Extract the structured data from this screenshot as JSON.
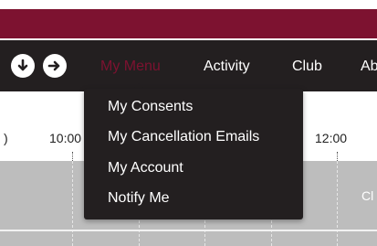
{
  "navbar": {
    "items": [
      {
        "label": "My Menu",
        "active": true
      },
      {
        "label": "Activity"
      },
      {
        "label": "Club"
      },
      {
        "label": "Ab"
      }
    ],
    "icons": [
      "circle-arrow-down-icon",
      "circle-arrow-right-icon"
    ]
  },
  "dropdown": {
    "items": [
      {
        "label": "My Consents"
      },
      {
        "label": "My Cancellation Emails"
      },
      {
        "label": "My Account"
      },
      {
        "label": "Notify Me"
      }
    ]
  },
  "timeline": {
    "labels": [
      ")",
      "10:00",
      "12:00"
    ]
  },
  "grid": {
    "partial_text": "Cl"
  },
  "colors": {
    "brand": "#7d1230",
    "navbar": "#231f20",
    "grid": "#bdbdbd"
  }
}
